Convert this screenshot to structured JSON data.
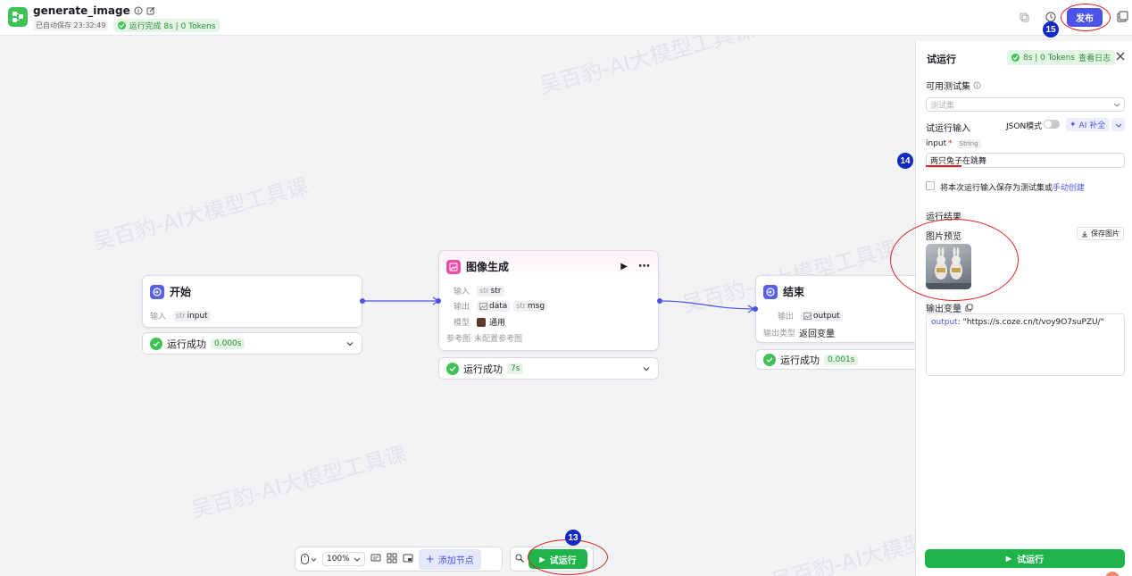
{
  "header": {
    "app_name": "generate_image",
    "autosave": "已自动保存 23:32:49",
    "run_status": "运行完成 8s | 0 Tokens",
    "publish_label": "发布"
  },
  "annotations": {
    "step_13": "13",
    "step_14": "14",
    "step_15": "15"
  },
  "watermark_text": "吴百豹-AI大模型工具课",
  "nodes": {
    "start": {
      "title": "开始",
      "input_label": "输入",
      "input_type": "str",
      "input_name": "input",
      "status": "运行成功",
      "time": "0.000s"
    },
    "image_gen": {
      "title": "图像生成",
      "input_label": "输入",
      "input_type": "str",
      "input_name": "str",
      "output_label": "输出",
      "output1_name": "data",
      "output2_type": "str",
      "output2_name": "msg",
      "model_label": "模型",
      "model_value": "通用",
      "ref_label": "参考图",
      "ref_value": "未配置参考图",
      "status": "运行成功",
      "time": "7s"
    },
    "end": {
      "title": "结束",
      "output_label": "输出",
      "output_name": "output",
      "output_type_label": "输出类型",
      "output_type_value": "返回变量",
      "status": "运行成功",
      "time": "0.001s"
    }
  },
  "toolbar": {
    "zoom": "100%",
    "add_node": "添加节点",
    "run": "试运行"
  },
  "panel": {
    "title": "试运行",
    "run_badge": "8s | 0 Tokens",
    "view_log": "查看日志",
    "test_set_label": "可用测试集",
    "test_set_placeholder": "测试集",
    "run_input_label": "试运行输入",
    "json_mode": "JSON模式",
    "ai_fill": "AI 补全",
    "input_name": "input",
    "input_required": "*",
    "input_type": "String",
    "input_value": "两只兔子在跳舞",
    "save_as_test": "将本次运行输入保存为测试集或",
    "manual_create": "手动创建",
    "result_label": "运行结果",
    "preview_label": "图片预览",
    "save_image": "保存图片",
    "output_var_label": "输出变量",
    "output_key": "output",
    "output_value": "\"https://s.coze.cn/t/voy9O7suPZU/\"",
    "run_button": "试运行"
  },
  "colors": {
    "accent": "#4d53e8",
    "success": "#1fb44a",
    "annotation_red": "#e02020",
    "badge_blue": "#1428c4"
  }
}
